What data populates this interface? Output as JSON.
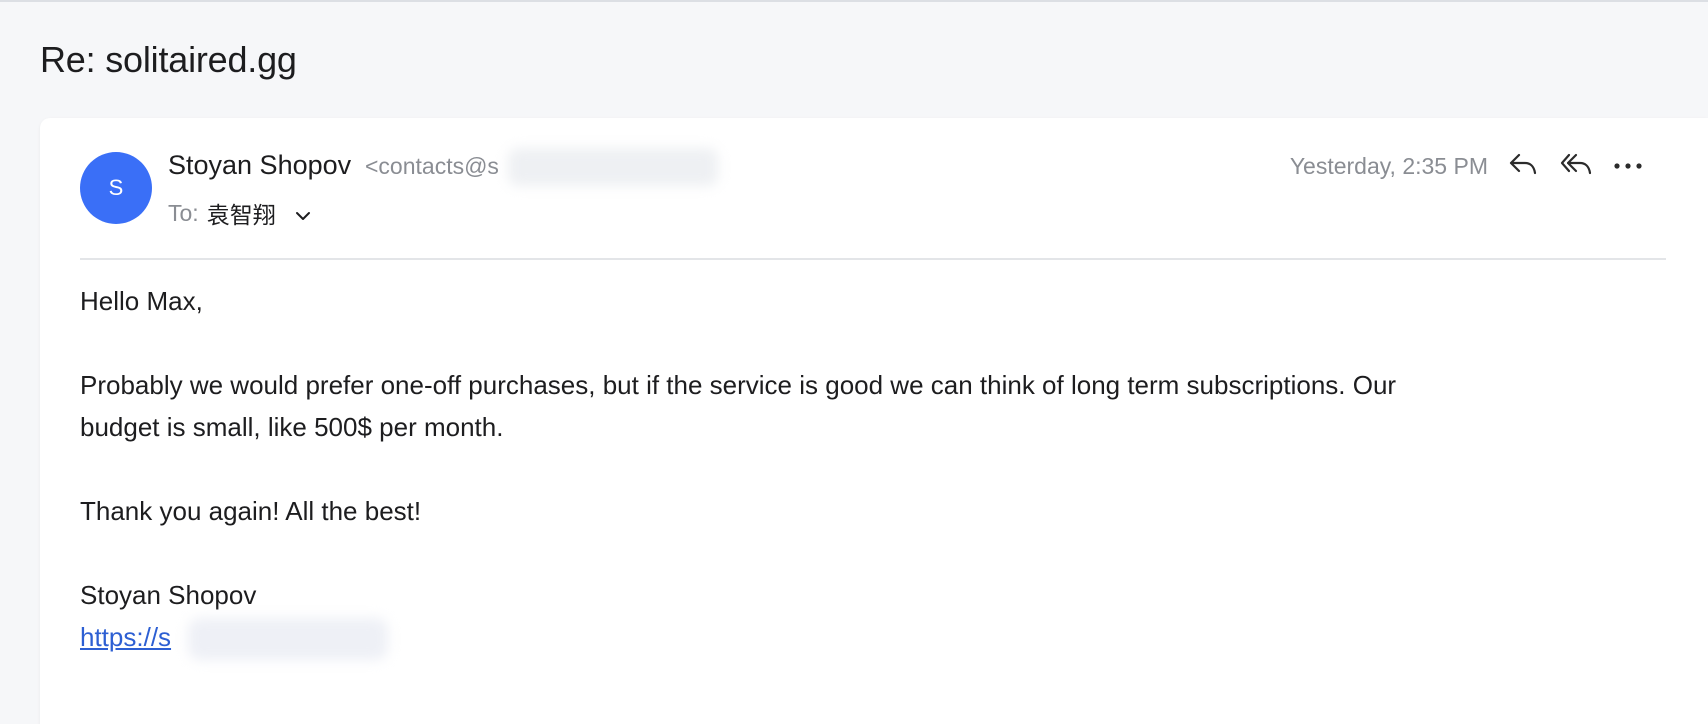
{
  "subject": "Re: solitaired.gg",
  "message": {
    "avatar_letter": "S",
    "sender_name": "Stoyan Shopov",
    "sender_email_visible": "<contacts@s",
    "to_label": "To:",
    "to_name": "袁智翔",
    "timestamp": "Yesterday, 2:35 PM",
    "body": {
      "greeting": "Hello Max,",
      "paragraph1_line1": "Probably we would prefer one-off purchases, but if the service is good we can think of long term subscriptions. Our",
      "paragraph1_line2": "budget is small, like 500$ per month.",
      "thanks": "Thank you again! All the best!",
      "signature_name": "Stoyan Shopov",
      "signature_link_visible": "https://s"
    }
  },
  "icons": {
    "reply": "reply-icon",
    "reply_all": "reply-all-icon",
    "more": "more-icon",
    "chevron": "chevron-down-icon"
  },
  "colors": {
    "avatar": "#3a6ff7",
    "link": "#2d5fd3",
    "muted_text": "#8a8d93",
    "background": "#f6f7f9"
  }
}
